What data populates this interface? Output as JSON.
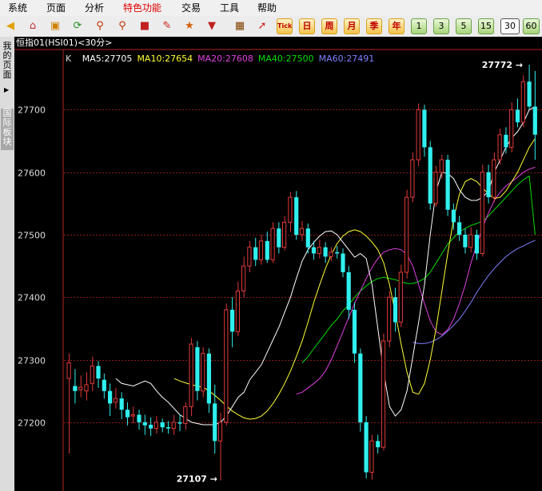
{
  "menu": [
    {
      "label": "系统",
      "active": false
    },
    {
      "label": "页面",
      "active": false
    },
    {
      "label": "分析",
      "active": false
    },
    {
      "label": "特色功能",
      "active": true
    },
    {
      "label": "交易",
      "active": false
    },
    {
      "label": "工具",
      "active": false
    },
    {
      "label": "帮助",
      "active": false
    }
  ],
  "toolbar": {
    "icons": [
      "back-arrow-icon",
      "home-icon",
      "funds-icon",
      "refresh-icon",
      "zoom-in-icon",
      "zoom-out-icon",
      "window-icon",
      "draw-pen-icon",
      "indicator-icon",
      "filter-icon",
      "table-icon",
      "chart-icon"
    ],
    "text_buttons": [
      "Tick",
      "日",
      "周",
      "月",
      "季",
      "年"
    ],
    "number_buttons": [
      "1",
      "3",
      "5",
      "15",
      "30",
      "60"
    ],
    "selected_period": "30"
  },
  "side_tabs": {
    "tab1": "我的页面",
    "tab2": "国际板块"
  },
  "chart_header": {
    "title": "恒指01(HSI01)<30分>",
    "k_label": "K"
  },
  "colors": {
    "up": "#e23a3a",
    "down": "#2ff0ee",
    "ma5": "#ffffff",
    "ma10": "#ffff33",
    "ma20": "#e040e0",
    "ma40": "#00dd00",
    "ma60": "#8080ff",
    "grid": "#8b1a1a",
    "axis_text": "#dddddd"
  },
  "chart_data": {
    "type": "candlestick",
    "title": "恒指01(HSI01)<30分>",
    "y_ticks": [
      27200,
      27300,
      27400,
      27500,
      27600,
      27700
    ],
    "ylim": [
      27090,
      27790
    ],
    "grid": true,
    "high_marker": {
      "label": "27772",
      "value": 27772
    },
    "low_marker": {
      "label": "27107",
      "value": 27107
    },
    "ma_legend": [
      {
        "name": "MA5",
        "value": "27705",
        "color": "#ffffff"
      },
      {
        "name": "MA10",
        "value": "27654",
        "color": "#ffff33"
      },
      {
        "name": "MA20",
        "value": "27608",
        "color": "#e040e0"
      },
      {
        "name": "MA40",
        "value": "27500",
        "color": "#00dd00"
      },
      {
        "name": "MA60",
        "value": "27491",
        "color": "#8080ff"
      }
    ],
    "candles": [
      [
        27270,
        27295,
        27310,
        27150
      ],
      [
        27258,
        27250,
        27285,
        27230
      ],
      [
        27252,
        27256,
        27275,
        27240
      ],
      [
        27250,
        27260,
        27280,
        27235
      ],
      [
        27262,
        27290,
        27305,
        27250
      ],
      [
        27290,
        27270,
        27298,
        27255
      ],
      [
        27268,
        27250,
        27278,
        27238
      ],
      [
        27250,
        27230,
        27262,
        27210
      ],
      [
        27232,
        27238,
        27255,
        27222
      ],
      [
        27238,
        27220,
        27248,
        27205
      ],
      [
        27220,
        27208,
        27232,
        27195
      ],
      [
        27210,
        27212,
        27225,
        27198
      ],
      [
        27212,
        27200,
        27220,
        27188
      ],
      [
        27200,
        27195,
        27212,
        27180
      ],
      [
        27196,
        27190,
        27208,
        27178
      ],
      [
        27190,
        27200,
        27210,
        27182
      ],
      [
        27200,
        27192,
        27206,
        27184
      ],
      [
        27192,
        27190,
        27202,
        27182
      ],
      [
        27190,
        27200,
        27212,
        27180
      ],
      [
        27200,
        27198,
        27212,
        27186
      ],
      [
        27198,
        27225,
        27232,
        27188
      ],
      [
        27225,
        27325,
        27335,
        27210
      ],
      [
        27320,
        27250,
        27330,
        27235
      ],
      [
        27250,
        27310,
        27320,
        27240
      ],
      [
        27310,
        27230,
        27318,
        27215
      ],
      [
        27230,
        27170,
        27260,
        27150
      ],
      [
        27170,
        27200,
        27215,
        27107
      ],
      [
        27200,
        27380,
        27390,
        27195
      ],
      [
        27380,
        27345,
        27400,
        27320
      ],
      [
        27345,
        27410,
        27425,
        27338
      ],
      [
        27410,
        27450,
        27465,
        27400
      ],
      [
        27450,
        27480,
        27490,
        27440
      ],
      [
        27480,
        27460,
        27495,
        27450
      ],
      [
        27460,
        27490,
        27500,
        27452
      ],
      [
        27490,
        27460,
        27505,
        27455
      ],
      [
        27460,
        27510,
        27520,
        27455
      ],
      [
        27510,
        27480,
        27520,
        27470
      ],
      [
        27480,
        27520,
        27530,
        27475
      ],
      [
        27520,
        27560,
        27568,
        27505
      ],
      [
        27560,
        27500,
        27570,
        27492
      ],
      [
        27500,
        27510,
        27522,
        27490
      ],
      [
        27510,
        27480,
        27518,
        27470
      ],
      [
        27480,
        27470,
        27490,
        27460
      ],
      [
        27470,
        27480,
        27492,
        27462
      ],
      [
        27480,
        27465,
        27488,
        27455
      ],
      [
        27465,
        27472,
        27480,
        27458
      ],
      [
        27472,
        27470,
        27482,
        27462
      ],
      [
        27470,
        27440,
        27478,
        27432
      ],
      [
        27440,
        27380,
        27450,
        27365
      ],
      [
        27380,
        27310,
        27392,
        27295
      ],
      [
        27310,
        27200,
        27318,
        27185
      ],
      [
        27200,
        27120,
        27210,
        27110
      ],
      [
        27120,
        27170,
        27180,
        27108
      ],
      [
        27170,
        27160,
        27180,
        27150
      ],
      [
        27160,
        27330,
        27342,
        27155
      ],
      [
        27330,
        27400,
        27410,
        27320
      ],
      [
        27400,
        27360,
        27415,
        27345
      ],
      [
        27360,
        27440,
        27452,
        27352
      ],
      [
        27440,
        27560,
        27572,
        27430
      ],
      [
        27560,
        27620,
        27632,
        27552
      ],
      [
        27620,
        27700,
        27710,
        27610
      ],
      [
        27700,
        27640,
        27708,
        27625
      ],
      [
        27640,
        27550,
        27650,
        27540
      ],
      [
        27550,
        27600,
        27610,
        27545
      ],
      [
        27600,
        27620,
        27628,
        27590
      ],
      [
        27620,
        27540,
        27628,
        27530
      ],
      [
        27540,
        27520,
        27550,
        27508
      ],
      [
        27520,
        27500,
        27530,
        27490
      ],
      [
        27500,
        27480,
        27510,
        27470
      ],
      [
        27480,
        27500,
        27512,
        27472
      ],
      [
        27500,
        27470,
        27508,
        27460
      ],
      [
        27470,
        27600,
        27612,
        27465
      ],
      [
        27600,
        27560,
        27612,
        27550
      ],
      [
        27560,
        27620,
        27632,
        27552
      ],
      [
        27620,
        27660,
        27670,
        27612
      ],
      [
        27660,
        27640,
        27672,
        27630
      ],
      [
        27640,
        27700,
        27712,
        27632
      ],
      [
        27700,
        27680,
        27718,
        27672
      ],
      [
        27680,
        27745,
        27755,
        27672
      ],
      [
        27745,
        27705,
        27772,
        27700
      ],
      [
        27705,
        27660,
        27762,
        27620
      ]
    ],
    "ma5": [
      27270,
      27262,
      27260,
      27258,
      27262,
      27266,
      27262,
      27250,
      27240,
      27232,
      27222,
      27212,
      27206,
      27200,
      27198,
      27196,
      27196,
      27196,
      27200,
      27210,
      27225,
      27240,
      27248,
      27268,
      27280,
      27292,
      27312,
      27332,
      27352,
      27376,
      27400,
      27430,
      27458,
      27476,
      27488,
      27498,
      27505,
      27506,
      27500,
      27488,
      27476,
      27464,
      27470,
      27462,
      27420,
      27350,
      27280,
      27225,
      27210,
      27220,
      27250,
      27305,
      27360,
      27420,
      27500,
      27570,
      27600,
      27598,
      27590,
      27572,
      27560,
      27555,
      27555,
      27560,
      27570,
      27600,
      27620,
      27640,
      27655,
      27665,
      27680,
      27700,
      27705
    ],
    "ma10": [
      27270,
      27266,
      27263,
      27260,
      27258,
      27256,
      27250,
      27243,
      27235,
      27226,
      27218,
      27212,
      27207,
      27205,
      27206,
      27210,
      27218,
      27230,
      27245,
      27262,
      27282,
      27305,
      27330,
      27360,
      27392,
      27420,
      27446,
      27468,
      27486,
      27498,
      27505,
      27508,
      27505,
      27498,
      27488,
      27476,
      27455,
      27420,
      27375,
      27325,
      27280,
      27248,
      27245,
      27262,
      27300,
      27350,
      27410,
      27470,
      27525,
      27565,
      27585,
      27590,
      27585,
      27575,
      27565,
      27558,
      27560,
      27570,
      27585,
      27600,
      27620,
      27640,
      27654
    ],
    "ma20": [
      27245,
      27248,
      27255,
      27262,
      27270,
      27282,
      27300,
      27322,
      27345,
      27368,
      27390,
      27410,
      27430,
      27448,
      27462,
      27472,
      27476,
      27478,
      27476,
      27468,
      27450,
      27420,
      27390,
      27362,
      27345,
      27340,
      27348,
      27365,
      27390,
      27420,
      27455,
      27485,
      27512,
      27535,
      27555,
      27568,
      27578,
      27585,
      27592,
      27600,
      27605,
      27608
    ],
    "ma40": [
      27295,
      27305,
      27318,
      27330,
      27342,
      27355,
      27365,
      27378,
      27388,
      27400,
      27410,
      27418,
      27425,
      27430,
      27432,
      27430,
      27428,
      27425,
      27422,
      27422,
      27425,
      27430,
      27440,
      27455,
      27470,
      27485,
      27495,
      27505,
      27510,
      27515,
      27518,
      27522,
      27530,
      27540,
      27550,
      27560,
      27570,
      27580,
      27588,
      27594,
      27500
    ],
    "ma60": [
      27328,
      27326,
      27326,
      27328,
      27332,
      27338,
      27346,
      27355,
      27365,
      27378,
      27392,
      27408,
      27422,
      27435,
      27446,
      27456,
      27465,
      27472,
      27478,
      27482,
      27487,
      27491
    ]
  }
}
